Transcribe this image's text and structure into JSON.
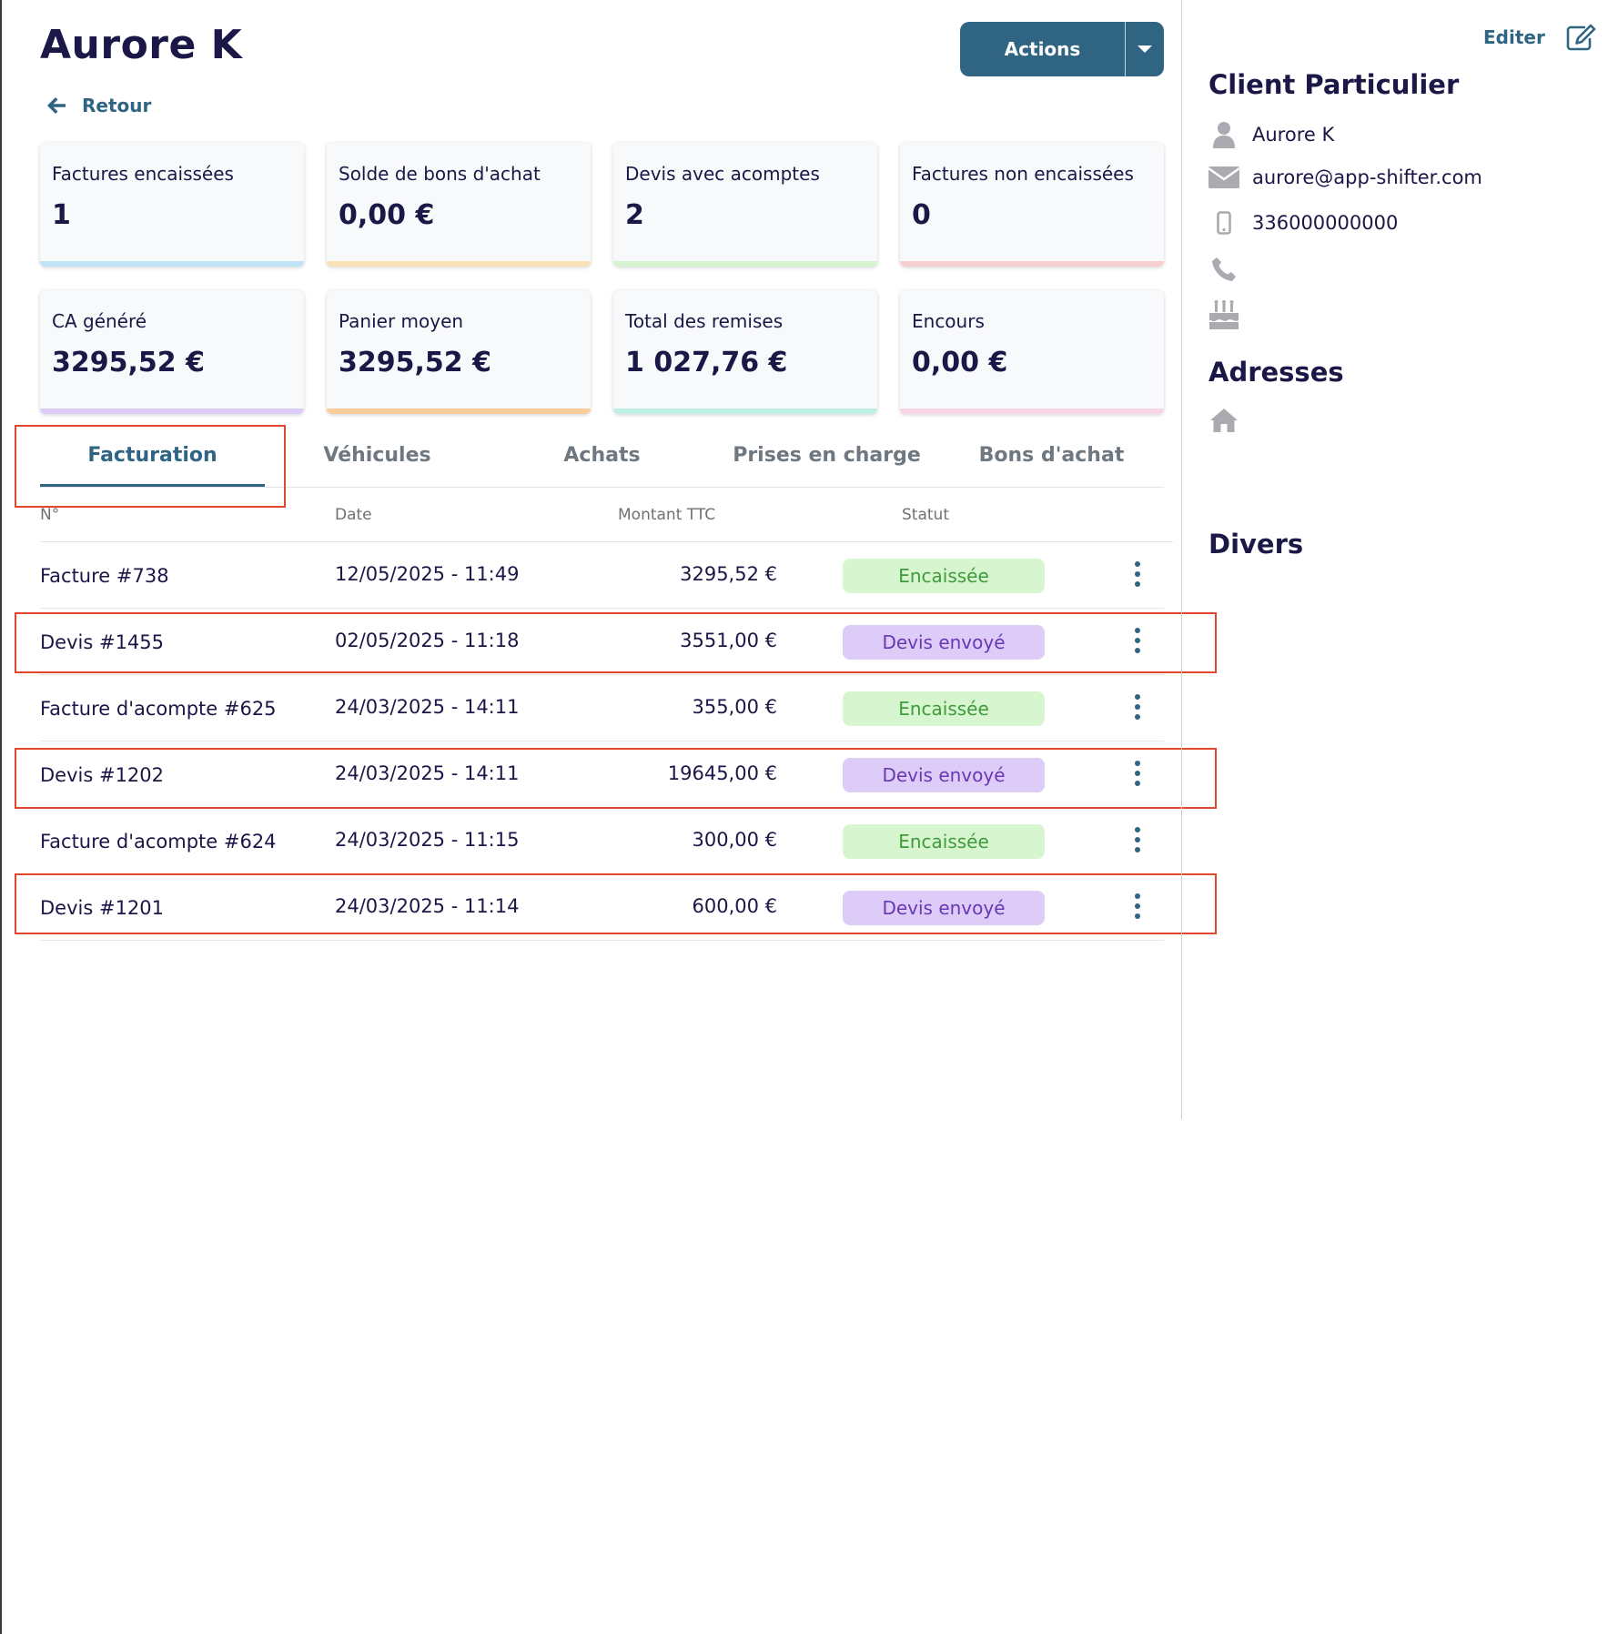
{
  "header": {
    "title": "Aurore K",
    "actions_label": "Actions",
    "back_label": "Retour"
  },
  "stats": [
    {
      "label": "Factures encaissées",
      "value": "1",
      "color": "#bfe3f7"
    },
    {
      "label": "Solde de bons d'achat",
      "value": "0,00 €",
      "color": "#fae1b6"
    },
    {
      "label": "Devis avec acomptes",
      "value": "2",
      "color": "#d6f3cf"
    },
    {
      "label": "Factures non encaissées",
      "value": "0",
      "color": "#f7cfcf"
    },
    {
      "label": "CA généré",
      "value": "3295,52 €",
      "color": "#dcccf7"
    },
    {
      "label": "Panier moyen",
      "value": "3295,52 €",
      "color": "#f8cd9b"
    },
    {
      "label": "Total des remises",
      "value": "1 027,76 €",
      "color": "#bfeee4"
    },
    {
      "label": "Encours",
      "value": "0,00 €",
      "color": "#f6d6e6"
    }
  ],
  "tabs": [
    "Facturation",
    "Véhicules",
    "Achats",
    "Prises en charge",
    "Bons d'achat"
  ],
  "table": {
    "columns": [
      "N°",
      "Date",
      "Montant TTC",
      "Statut"
    ],
    "rows": [
      {
        "num": "Facture #738",
        "date": "12/05/2025 - 11:49",
        "amount": "3295,52 €",
        "status": "Encaissée"
      },
      {
        "num": "Devis #1455",
        "date": "02/05/2025 - 11:18",
        "amount": "3551,00 €",
        "status": "Devis envoyé"
      },
      {
        "num": "Facture d'acompte #625",
        "date": "24/03/2025 - 14:11",
        "amount": "355,00 €",
        "status": "Encaissée"
      },
      {
        "num": "Devis #1202",
        "date": "24/03/2025 - 14:11",
        "amount": "19645,00 €",
        "status": "Devis envoyé"
      },
      {
        "num": "Facture d'acompte #624",
        "date": "24/03/2025 - 11:15",
        "amount": "300,00 €",
        "status": "Encaissée"
      },
      {
        "num": "Devis #1201",
        "date": "24/03/2025 - 11:14",
        "amount": "600,00 €",
        "status": "Devis envoyé"
      }
    ]
  },
  "sidebar": {
    "edit_label": "Editer",
    "client_heading": "Client Particulier",
    "name": "Aurore K",
    "email": "aurore@app-shifter.com",
    "mobile": "336000000000",
    "addresses_heading": "Adresses",
    "misc_heading": "Divers"
  },
  "colors": {
    "accent": "#2f6583",
    "title": "#1b1747",
    "highlight": "#e1472d",
    "badge_paid_bg": "#d7f6cf",
    "badge_sent_bg": "#dcccf7"
  },
  "icons": [
    "arrow-left-icon",
    "caret-down-icon",
    "edit-icon",
    "user-icon",
    "envelope-icon",
    "mobile-icon",
    "phone-icon",
    "birthday-cake-icon",
    "home-icon",
    "kebab-menu-icon"
  ]
}
